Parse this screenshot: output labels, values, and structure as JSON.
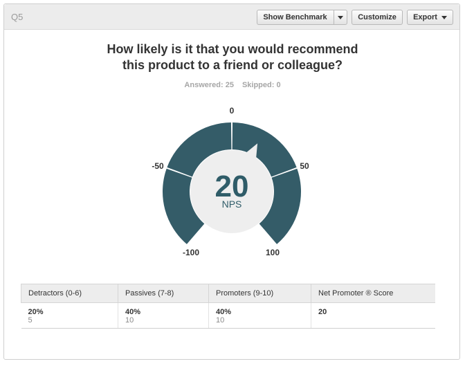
{
  "header": {
    "question_label": "Q5",
    "show_benchmark_label": "Show Benchmark",
    "customize_label": "Customize",
    "export_label": "Export"
  },
  "question": {
    "title_line1": "How likely is it that you would recommend",
    "title_line2": "this product to a friend or colleague?"
  },
  "stats": {
    "answered": "Answered: 25",
    "skipped": "Skipped: 0"
  },
  "chart_data": {
    "type": "gauge",
    "score": 20,
    "unit_label": "NPS",
    "range": [
      -100,
      100
    ],
    "tick_labels": [
      "-100",
      "-50",
      "0",
      "50",
      "100"
    ],
    "segments": [
      {
        "from": -100,
        "to": -50
      },
      {
        "from": -50,
        "to": 0
      },
      {
        "from": 0,
        "to": 50
      },
      {
        "from": 50,
        "to": 100
      }
    ],
    "score_text": "20",
    "color": "#345c68",
    "center_color": "#eeeeee"
  },
  "summary": {
    "headers": [
      "Detractors (0-6)",
      "Passives (7-8)",
      "Promoters (9-10)",
      "Net Promoter ® Score"
    ],
    "cells": [
      {
        "pct": "20%",
        "count": "5"
      },
      {
        "pct": "40%",
        "count": "10"
      },
      {
        "pct": "40%",
        "count": "10"
      },
      {
        "pct": "20",
        "count": ""
      }
    ]
  }
}
